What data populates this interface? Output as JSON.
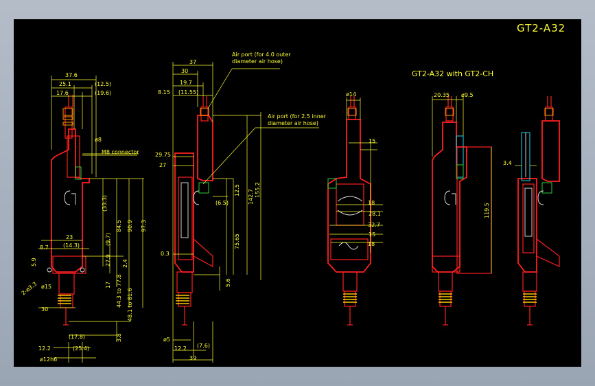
{
  "title": "GT2-A32",
  "subtitle": "GT2-A32 with GT2-CH",
  "notes": {
    "air_port_outer_line1": "Air port (for 4.0 outer",
    "air_port_outer_line2": "diameter air hose)",
    "air_port_inner_line1": "Air port (for 2.5 inner",
    "air_port_inner_line2": "diameter air hose)",
    "connector": "M8 connector"
  },
  "view1": {
    "d_37_6": "37.6",
    "d_25_1": "25.1",
    "d_12_5": "(12.5)",
    "d_17_6": "17.6",
    "d_19_6": "(19.6)",
    "d_8": "ø8",
    "d_33_3": "(33.3)",
    "d_84_5": "84.5",
    "d_90_9": "90.9",
    "d_97_3": "97.3",
    "d_23": "23",
    "d_8_7": "8.7",
    "d_14_3": "(14.3)",
    "d_9_7": "(9.7)",
    "d_5_9": "5.9",
    "d_27_9": "27.9",
    "d_2_4": "2.4",
    "d_2m3": "2-ø3.3",
    "d_15": "ø15",
    "d_17": "17",
    "d_77_8": "44.3 to 77.8",
    "d_81_6": "48.1 to 81.6",
    "d_30": "30",
    "d_3_8": "3.8",
    "d_17_8": "(17.8)",
    "d_12_2": "12.2",
    "d_25_4": "(25.4)",
    "d_12h6": "ø12h6"
  },
  "view2": {
    "d_37": "37",
    "d_30": "30",
    "d_19_7": "19.7",
    "d_8_15": "8.15",
    "d_11_55": "(11.55)",
    "d_29_75": "29.75",
    "d_27": "27",
    "d_12_5": "12.5",
    "d_6_5": "(6.5)",
    "d_142_7": "142.7",
    "d_155_2": "155.2",
    "d_75_65": "75.65",
    "d_0_3": "0.3",
    "d_5_6": "5.6",
    "d_5": "ø5",
    "d_12_2": "12.2",
    "d_7_6": "(7.6)",
    "d_39": "39"
  },
  "view3": {
    "d_14": "ø14",
    "d_15": "15",
    "d_18a": "18",
    "d_28_1": "28.1",
    "d_32_7": "32.7",
    "d_15b": "15",
    "d_18b": "18"
  },
  "view4": {
    "d_20_35": "20.35",
    "d_9_5": "ø9.5",
    "d_119_5": "119.5"
  },
  "view5": {
    "d_3_4": "3.4"
  }
}
